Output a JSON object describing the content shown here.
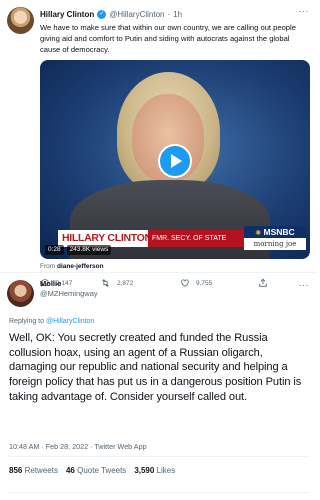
{
  "quoted_tweet": {
    "author_name": "Hillary Clinton",
    "author_handle": "@HillaryClinton",
    "separator": "·",
    "age": "1h",
    "more_label": "···",
    "text": "We have to make sure that within our own country, we are calling out people giving aid and comfort to Putin and siding with autocrats against the global cause of democracy.",
    "video": {
      "lower_third_name": "HILLARY CLINTON",
      "lower_third_title": "FMR. SECY. OF STATE",
      "network": "MSNBC",
      "network_icon": "peacock-icon",
      "show": "morning joe",
      "elapsed": "0:28",
      "views": "243.8K views"
    },
    "from_prefix": "From",
    "from_user": "diane-jefferson",
    "actions": {
      "replies": "2,147",
      "retweets": "2,872",
      "likes": "9,755"
    }
  },
  "reply_tweet": {
    "author_name": "Mollie",
    "author_handle": "@MZHemingway",
    "more_label": "···",
    "replying_prefix": "Replying to",
    "replying_to": "@HillaryClinton",
    "text": "Well, OK: You secretly created and funded the Russia collusion hoax, using an agent of a Russian oligarch, damaging our republic and national security and helping a foreign policy that has put us in a dangerous position Putin is taking advantage of. Consider yourself called out.",
    "timestamp": "10:48 AM · Feb 28, 2022 · Twitter Web App",
    "stats": {
      "retweets_count": "856",
      "retweets_label": "Retweets",
      "quotes_count": "46",
      "quotes_label": "Quote Tweets",
      "likes_count": "3,590",
      "likes_label": "Likes"
    }
  },
  "colors": {
    "accent": "#1d9bf0",
    "text_primary": "#0f1419",
    "text_secondary": "#536471",
    "msnbc_red": "#b3121e"
  }
}
